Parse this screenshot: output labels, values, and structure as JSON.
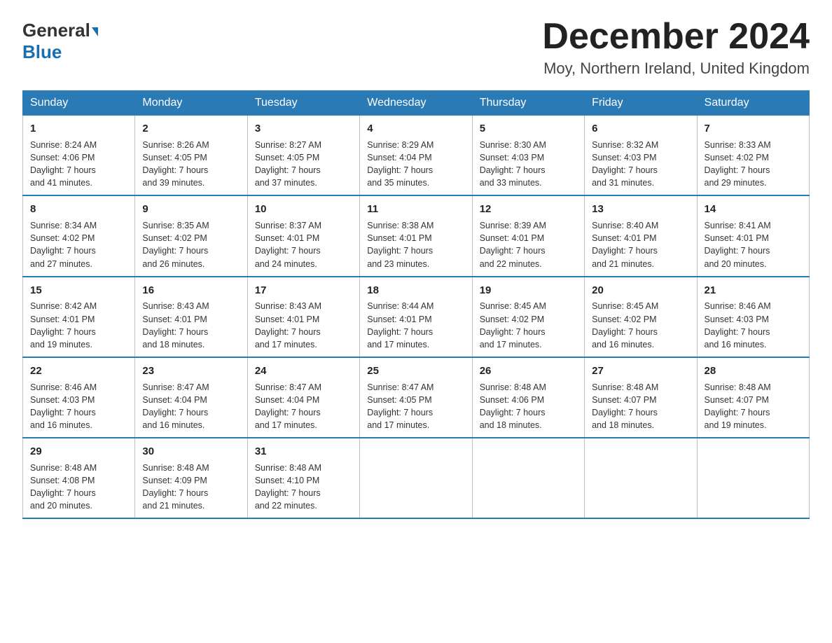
{
  "logo": {
    "general": "General",
    "blue": "Blue",
    "arrow": "▶"
  },
  "title": "December 2024",
  "location": "Moy, Northern Ireland, United Kingdom",
  "weekdays": [
    "Sunday",
    "Monday",
    "Tuesday",
    "Wednesday",
    "Thursday",
    "Friday",
    "Saturday"
  ],
  "weeks": [
    [
      {
        "day": "1",
        "sunrise": "8:24 AM",
        "sunset": "4:06 PM",
        "daylight": "7 hours and 41 minutes."
      },
      {
        "day": "2",
        "sunrise": "8:26 AM",
        "sunset": "4:05 PM",
        "daylight": "7 hours and 39 minutes."
      },
      {
        "day": "3",
        "sunrise": "8:27 AM",
        "sunset": "4:05 PM",
        "daylight": "7 hours and 37 minutes."
      },
      {
        "day": "4",
        "sunrise": "8:29 AM",
        "sunset": "4:04 PM",
        "daylight": "7 hours and 35 minutes."
      },
      {
        "day": "5",
        "sunrise": "8:30 AM",
        "sunset": "4:03 PM",
        "daylight": "7 hours and 33 minutes."
      },
      {
        "day": "6",
        "sunrise": "8:32 AM",
        "sunset": "4:03 PM",
        "daylight": "7 hours and 31 minutes."
      },
      {
        "day": "7",
        "sunrise": "8:33 AM",
        "sunset": "4:02 PM",
        "daylight": "7 hours and 29 minutes."
      }
    ],
    [
      {
        "day": "8",
        "sunrise": "8:34 AM",
        "sunset": "4:02 PM",
        "daylight": "7 hours and 27 minutes."
      },
      {
        "day": "9",
        "sunrise": "8:35 AM",
        "sunset": "4:02 PM",
        "daylight": "7 hours and 26 minutes."
      },
      {
        "day": "10",
        "sunrise": "8:37 AM",
        "sunset": "4:01 PM",
        "daylight": "7 hours and 24 minutes."
      },
      {
        "day": "11",
        "sunrise": "8:38 AM",
        "sunset": "4:01 PM",
        "daylight": "7 hours and 23 minutes."
      },
      {
        "day": "12",
        "sunrise": "8:39 AM",
        "sunset": "4:01 PM",
        "daylight": "7 hours and 22 minutes."
      },
      {
        "day": "13",
        "sunrise": "8:40 AM",
        "sunset": "4:01 PM",
        "daylight": "7 hours and 21 minutes."
      },
      {
        "day": "14",
        "sunrise": "8:41 AM",
        "sunset": "4:01 PM",
        "daylight": "7 hours and 20 minutes."
      }
    ],
    [
      {
        "day": "15",
        "sunrise": "8:42 AM",
        "sunset": "4:01 PM",
        "daylight": "7 hours and 19 minutes."
      },
      {
        "day": "16",
        "sunrise": "8:43 AM",
        "sunset": "4:01 PM",
        "daylight": "7 hours and 18 minutes."
      },
      {
        "day": "17",
        "sunrise": "8:43 AM",
        "sunset": "4:01 PM",
        "daylight": "7 hours and 17 minutes."
      },
      {
        "day": "18",
        "sunrise": "8:44 AM",
        "sunset": "4:01 PM",
        "daylight": "7 hours and 17 minutes."
      },
      {
        "day": "19",
        "sunrise": "8:45 AM",
        "sunset": "4:02 PM",
        "daylight": "7 hours and 17 minutes."
      },
      {
        "day": "20",
        "sunrise": "8:45 AM",
        "sunset": "4:02 PM",
        "daylight": "7 hours and 16 minutes."
      },
      {
        "day": "21",
        "sunrise": "8:46 AM",
        "sunset": "4:03 PM",
        "daylight": "7 hours and 16 minutes."
      }
    ],
    [
      {
        "day": "22",
        "sunrise": "8:46 AM",
        "sunset": "4:03 PM",
        "daylight": "7 hours and 16 minutes."
      },
      {
        "day": "23",
        "sunrise": "8:47 AM",
        "sunset": "4:04 PM",
        "daylight": "7 hours and 16 minutes."
      },
      {
        "day": "24",
        "sunrise": "8:47 AM",
        "sunset": "4:04 PM",
        "daylight": "7 hours and 17 minutes."
      },
      {
        "day": "25",
        "sunrise": "8:47 AM",
        "sunset": "4:05 PM",
        "daylight": "7 hours and 17 minutes."
      },
      {
        "day": "26",
        "sunrise": "8:48 AM",
        "sunset": "4:06 PM",
        "daylight": "7 hours and 18 minutes."
      },
      {
        "day": "27",
        "sunrise": "8:48 AM",
        "sunset": "4:07 PM",
        "daylight": "7 hours and 18 minutes."
      },
      {
        "day": "28",
        "sunrise": "8:48 AM",
        "sunset": "4:07 PM",
        "daylight": "7 hours and 19 minutes."
      }
    ],
    [
      {
        "day": "29",
        "sunrise": "8:48 AM",
        "sunset": "4:08 PM",
        "daylight": "7 hours and 20 minutes."
      },
      {
        "day": "30",
        "sunrise": "8:48 AM",
        "sunset": "4:09 PM",
        "daylight": "7 hours and 21 minutes."
      },
      {
        "day": "31",
        "sunrise": "8:48 AM",
        "sunset": "4:10 PM",
        "daylight": "7 hours and 22 minutes."
      },
      null,
      null,
      null,
      null
    ]
  ]
}
